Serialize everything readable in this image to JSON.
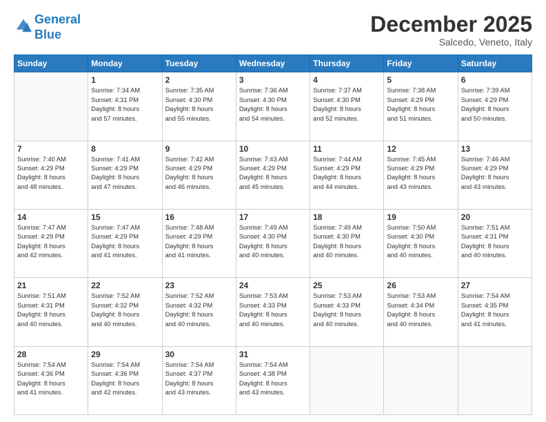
{
  "header": {
    "logo_line1": "General",
    "logo_line2": "Blue",
    "month": "December 2025",
    "location": "Salcedo, Veneto, Italy"
  },
  "days_of_week": [
    "Sunday",
    "Monday",
    "Tuesday",
    "Wednesday",
    "Thursday",
    "Friday",
    "Saturday"
  ],
  "weeks": [
    [
      {
        "day": "",
        "content": ""
      },
      {
        "day": "1",
        "content": "Sunrise: 7:34 AM\nSunset: 4:31 PM\nDaylight: 8 hours\nand 57 minutes."
      },
      {
        "day": "2",
        "content": "Sunrise: 7:35 AM\nSunset: 4:30 PM\nDaylight: 8 hours\nand 55 minutes."
      },
      {
        "day": "3",
        "content": "Sunrise: 7:36 AM\nSunset: 4:30 PM\nDaylight: 8 hours\nand 54 minutes."
      },
      {
        "day": "4",
        "content": "Sunrise: 7:37 AM\nSunset: 4:30 PM\nDaylight: 8 hours\nand 52 minutes."
      },
      {
        "day": "5",
        "content": "Sunrise: 7:38 AM\nSunset: 4:29 PM\nDaylight: 8 hours\nand 51 minutes."
      },
      {
        "day": "6",
        "content": "Sunrise: 7:39 AM\nSunset: 4:29 PM\nDaylight: 8 hours\nand 50 minutes."
      }
    ],
    [
      {
        "day": "7",
        "content": "Sunrise: 7:40 AM\nSunset: 4:29 PM\nDaylight: 8 hours\nand 48 minutes."
      },
      {
        "day": "8",
        "content": "Sunrise: 7:41 AM\nSunset: 4:29 PM\nDaylight: 8 hours\nand 47 minutes."
      },
      {
        "day": "9",
        "content": "Sunrise: 7:42 AM\nSunset: 4:29 PM\nDaylight: 8 hours\nand 46 minutes."
      },
      {
        "day": "10",
        "content": "Sunrise: 7:43 AM\nSunset: 4:29 PM\nDaylight: 8 hours\nand 45 minutes."
      },
      {
        "day": "11",
        "content": "Sunrise: 7:44 AM\nSunset: 4:29 PM\nDaylight: 8 hours\nand 44 minutes."
      },
      {
        "day": "12",
        "content": "Sunrise: 7:45 AM\nSunset: 4:29 PM\nDaylight: 8 hours\nand 43 minutes."
      },
      {
        "day": "13",
        "content": "Sunrise: 7:46 AM\nSunset: 4:29 PM\nDaylight: 8 hours\nand 43 minutes."
      }
    ],
    [
      {
        "day": "14",
        "content": "Sunrise: 7:47 AM\nSunset: 4:29 PM\nDaylight: 8 hours\nand 42 minutes."
      },
      {
        "day": "15",
        "content": "Sunrise: 7:47 AM\nSunset: 4:29 PM\nDaylight: 8 hours\nand 41 minutes."
      },
      {
        "day": "16",
        "content": "Sunrise: 7:48 AM\nSunset: 4:29 PM\nDaylight: 8 hours\nand 41 minutes."
      },
      {
        "day": "17",
        "content": "Sunrise: 7:49 AM\nSunset: 4:30 PM\nDaylight: 8 hours\nand 40 minutes."
      },
      {
        "day": "18",
        "content": "Sunrise: 7:49 AM\nSunset: 4:30 PM\nDaylight: 8 hours\nand 40 minutes."
      },
      {
        "day": "19",
        "content": "Sunrise: 7:50 AM\nSunset: 4:30 PM\nDaylight: 8 hours\nand 40 minutes."
      },
      {
        "day": "20",
        "content": "Sunrise: 7:51 AM\nSunset: 4:31 PM\nDaylight: 8 hours\nand 40 minutes."
      }
    ],
    [
      {
        "day": "21",
        "content": "Sunrise: 7:51 AM\nSunset: 4:31 PM\nDaylight: 8 hours\nand 40 minutes."
      },
      {
        "day": "22",
        "content": "Sunrise: 7:52 AM\nSunset: 4:32 PM\nDaylight: 8 hours\nand 40 minutes."
      },
      {
        "day": "23",
        "content": "Sunrise: 7:52 AM\nSunset: 4:32 PM\nDaylight: 8 hours\nand 40 minutes."
      },
      {
        "day": "24",
        "content": "Sunrise: 7:53 AM\nSunset: 4:33 PM\nDaylight: 8 hours\nand 40 minutes."
      },
      {
        "day": "25",
        "content": "Sunrise: 7:53 AM\nSunset: 4:33 PM\nDaylight: 8 hours\nand 40 minutes."
      },
      {
        "day": "26",
        "content": "Sunrise: 7:53 AM\nSunset: 4:34 PM\nDaylight: 8 hours\nand 40 minutes."
      },
      {
        "day": "27",
        "content": "Sunrise: 7:54 AM\nSunset: 4:35 PM\nDaylight: 8 hours\nand 41 minutes."
      }
    ],
    [
      {
        "day": "28",
        "content": "Sunrise: 7:54 AM\nSunset: 4:36 PM\nDaylight: 8 hours\nand 41 minutes."
      },
      {
        "day": "29",
        "content": "Sunrise: 7:54 AM\nSunset: 4:36 PM\nDaylight: 8 hours\nand 42 minutes."
      },
      {
        "day": "30",
        "content": "Sunrise: 7:54 AM\nSunset: 4:37 PM\nDaylight: 8 hours\nand 43 minutes."
      },
      {
        "day": "31",
        "content": "Sunrise: 7:54 AM\nSunset: 4:38 PM\nDaylight: 8 hours\nand 43 minutes."
      },
      {
        "day": "",
        "content": ""
      },
      {
        "day": "",
        "content": ""
      },
      {
        "day": "",
        "content": ""
      }
    ]
  ]
}
